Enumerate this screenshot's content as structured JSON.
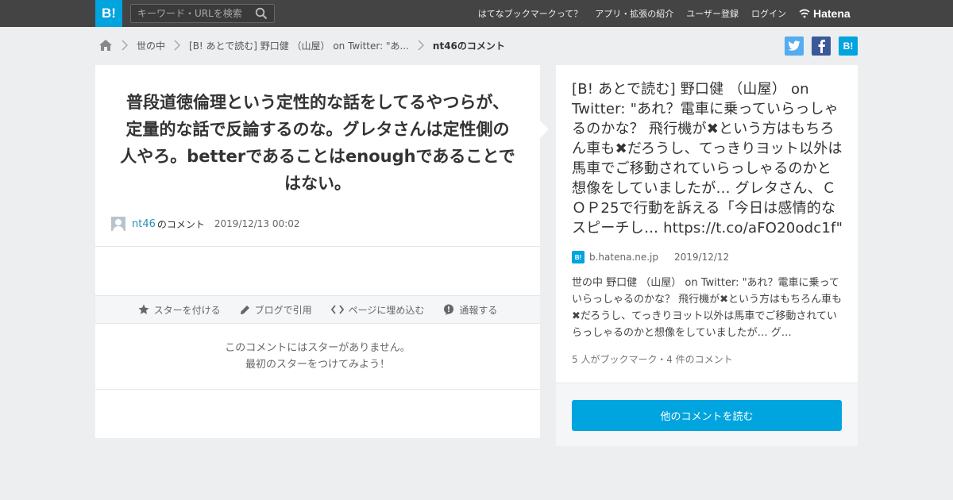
{
  "header": {
    "logo": "B!",
    "search_placeholder": "キーワード・URLを検索",
    "nav": [
      "はてなブックマークって？",
      "アプリ・拡張の紹介",
      "ユーザー登録",
      "ログイン"
    ],
    "brand": "Hatena"
  },
  "breadcrumb": {
    "category": "世の中",
    "entry": "[B! あとで読む] 野口健 （山屋） on Twitter: \"あ...",
    "current": "nt46のコメント"
  },
  "share": {
    "bookmark": "B!"
  },
  "comment": {
    "text": "普段道徳倫理という定性的な話をしてるやつらが、定量的な話で反論するのな。グレタさんは定性側の人やろ。betterであることはenoughであることではない。",
    "user": "nt46",
    "user_suffix": "のコメント",
    "date": "2019/12/13 00:02"
  },
  "actions": [
    "スターを付ける",
    "ブログで引用",
    "ページに埋め込む",
    "通報する"
  ],
  "stars": {
    "empty_line1": "このコメントにはスターがありません。",
    "empty_line2": "最初のスターをつけてみよう！"
  },
  "entry": {
    "title": "[B! あとで読む] 野口健 （山屋） on Twitter: \"あれ？電車に乗っていらっしゃるのかな？ 飛行機が✖という方はもちろん車も✖だろうし、てっきりヨット以外は馬車でご移動されていらっしゃるのかと想像をしていましたが… グレタさん、ＣＯＰ25で行動を訴える「今日は感情的なスピーチし… https://t.co/aFO20odc1f\"",
    "domain": "b.hatena.ne.jp",
    "date": "2019/12/12",
    "summary": "世の中 野口健 （山屋） on Twitter: \"あれ？電車に乗っていらっしゃるのかな？ 飛行機が✖という方はもちろん車も✖だろうし、てっきりヨット以外は馬車でご移動されていらっしゃるのかと想像をしていましたが… グ…",
    "count": "5 人がブックマーク・4 件のコメント",
    "more_button": "他のコメントを読む"
  },
  "colors": {
    "accent": "#00a4de",
    "twitter": "#55acee",
    "facebook": "#3b5998",
    "header_bg": "#444444"
  }
}
